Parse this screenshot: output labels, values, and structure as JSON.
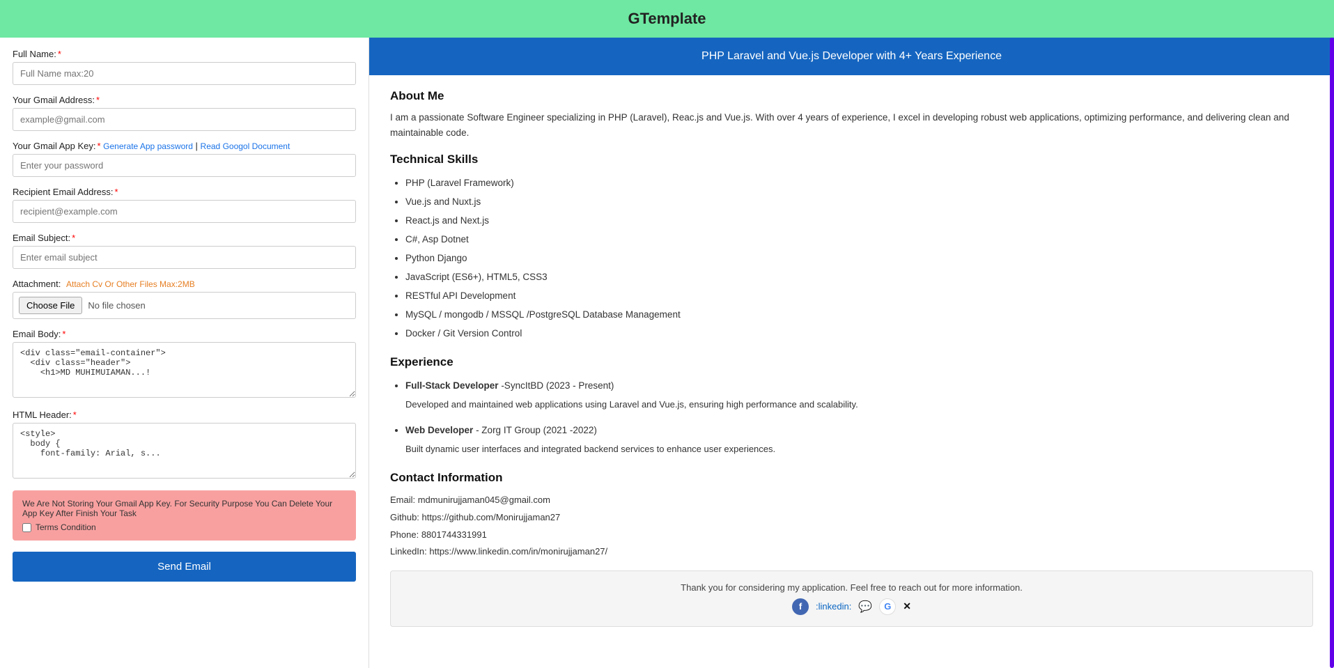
{
  "header": {
    "title": "GTemplate"
  },
  "form": {
    "full_name_label": "Full Name:",
    "full_name_placeholder": "Full Name max:20",
    "gmail_label": "Your Gmail Address:",
    "gmail_placeholder": "example@gmail.com",
    "app_key_label": "Your Gmail App Key:",
    "app_key_generate": "Generate App password",
    "app_key_separator": "|",
    "app_key_read": "Read Googol Document",
    "app_key_placeholder": "Enter your password",
    "recipient_label": "Recipient Email Address:",
    "recipient_placeholder": "recipient@example.com",
    "subject_label": "Email Subject:",
    "subject_placeholder": "Enter email subject",
    "attachment_label": "Attachment:",
    "attachment_hint": "Attach Cv Or Other Files Max:2MB",
    "file_choose_btn": "Choose File",
    "file_no_file": "No file chosen",
    "email_body_label": "Email Body:",
    "email_body_content": "<div class=\"email-container\">\n  <div class=\"header\">\n    <h1>MD MUHIMUIAMAN...!",
    "html_header_label": "HTML Header:",
    "html_header_content": "<style>\n  body {\n    font-family: Arial, s...",
    "security_notice": "We Are Not Storing Your Gmail App Key. For Security Purpose You Can Delete Your App Key After Finish Your Task",
    "terms_label": "Terms Condition",
    "send_btn": "Send Email"
  },
  "resume": {
    "blue_bar_text": "PHP Laravel and Vue.js Developer with 4+ Years Experience",
    "about_title": "About Me",
    "about_text": "I am a passionate Software Engineer specializing in PHP (Laravel), Reac.js and Vue.js. With over 4 years of experience, I excel in developing robust web applications, optimizing performance, and delivering clean and maintainable code.",
    "technical_title": "Technical Skills",
    "skills": [
      "PHP (Laravel Framework)",
      "Vue.js and Nuxt.js",
      "React.js and Next.js",
      "C#, Asp Dotnet",
      "Python Django",
      "JavaScript (ES6+), HTML5, CSS3",
      "RESTful API Development",
      "MySQL / mongodb /  MSSQL /PostgreSQL Database Management",
      "Docker / Git Version Control"
    ],
    "experience_title": "Experience",
    "experiences": [
      {
        "title": "Full-Stack Developer",
        "company": "-SyncItBD (2023 - Present)",
        "desc": "Developed and maintained web applications using Laravel and Vue.js, ensuring high performance and scalability."
      },
      {
        "title": "Web Developer",
        "company": "- Zorg IT Group (2021 -2022)",
        "desc": "Built dynamic user interfaces and integrated backend services to enhance user experiences."
      }
    ],
    "contact_title": "Contact Information",
    "contact_lines": [
      "Email: mdmunirujjaman045@gmail.com",
      "Github:  https://github.com/Monirujjaman27",
      "Phone: 8801744331991",
      "LinkedIn: https://www.linkedin.com/in/monirujjaman27/"
    ],
    "footer_text": "Thank you for considering my application. Feel free to reach out for more information.",
    "footer_icons": [
      "ⓕ",
      ":linkedin:",
      "💬",
      "🌐",
      "✖"
    ],
    "linkedin_icon": "f",
    "chat_icon": "💬",
    "google_icon": "G",
    "x_icon": "✕"
  }
}
